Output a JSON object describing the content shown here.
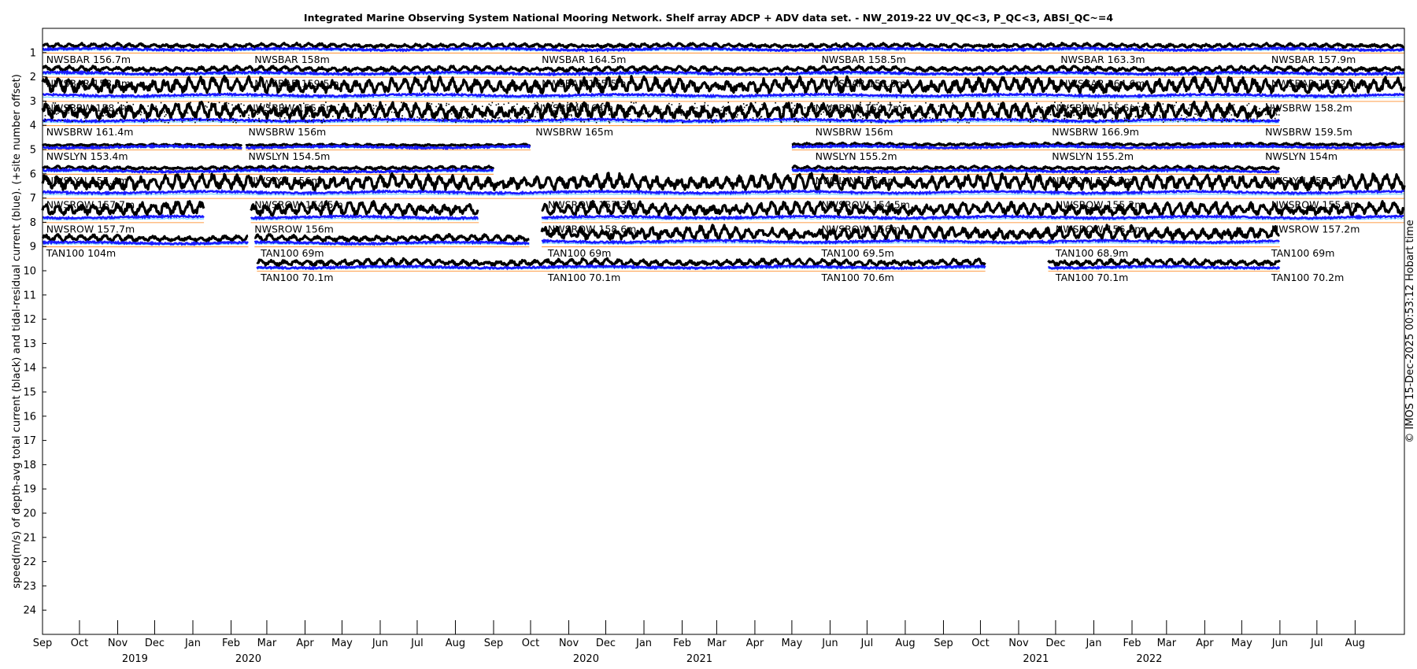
{
  "chart_data": {
    "type": "line",
    "title": "Integrated Marine Observing System National Mooring Network. Shelf array ADCP + ADV data set. - NW_2019-22 UV_QC<3, P_QC<3, ABSI_QC~=4",
    "ylabel": "speed(m/s) of depth-avg total current (black) and tidal-residual current (blue). (+site number offset)",
    "credit": "© IMOS 15-Dec-2025 00:53:12 Hobart time",
    "x_range": [
      "2019-09-01",
      "2022-09-10"
    ],
    "y_range": [
      25,
      0
    ],
    "y_reversed": true,
    "y_ticks": [
      "1",
      "2",
      "3",
      "4",
      "5",
      "6",
      "7",
      "8",
      "9",
      "10",
      "11",
      "12",
      "13",
      "14",
      "15",
      "16",
      "17",
      "18",
      "19",
      "20",
      "21",
      "22",
      "23",
      "24"
    ],
    "x_ticks": [
      {
        "date": "2019-09-01",
        "label": "Sep"
      },
      {
        "date": "2019-10-01",
        "label": "Oct"
      },
      {
        "date": "2019-11-01",
        "label": "Nov"
      },
      {
        "date": "2019-12-01",
        "label": "Dec"
      },
      {
        "date": "2020-01-01",
        "label": "Jan"
      },
      {
        "date": "2020-02-01",
        "label": "Feb"
      },
      {
        "date": "2020-03-01",
        "label": "Mar"
      },
      {
        "date": "2020-04-01",
        "label": "Apr"
      },
      {
        "date": "2020-05-01",
        "label": "May"
      },
      {
        "date": "2020-06-01",
        "label": "Jun"
      },
      {
        "date": "2020-07-01",
        "label": "Jul"
      },
      {
        "date": "2020-08-01",
        "label": "Aug"
      },
      {
        "date": "2020-09-01",
        "label": "Sep"
      },
      {
        "date": "2020-10-01",
        "label": "Oct"
      },
      {
        "date": "2020-11-01",
        "label": "Nov"
      },
      {
        "date": "2020-12-01",
        "label": "Dec"
      },
      {
        "date": "2021-01-01",
        "label": "Jan"
      },
      {
        "date": "2021-02-01",
        "label": "Feb"
      },
      {
        "date": "2021-03-01",
        "label": "Mar"
      },
      {
        "date": "2021-04-01",
        "label": "Apr"
      },
      {
        "date": "2021-05-01",
        "label": "May"
      },
      {
        "date": "2021-06-01",
        "label": "Jun"
      },
      {
        "date": "2021-07-01",
        "label": "Jul"
      },
      {
        "date": "2021-08-01",
        "label": "Aug"
      },
      {
        "date": "2021-09-01",
        "label": "Sep"
      },
      {
        "date": "2021-10-01",
        "label": "Oct"
      },
      {
        "date": "2021-11-01",
        "label": "Nov"
      },
      {
        "date": "2021-12-01",
        "label": "Dec"
      },
      {
        "date": "2022-01-01",
        "label": "Jan"
      },
      {
        "date": "2022-02-01",
        "label": "Feb"
      },
      {
        "date": "2022-03-01",
        "label": "Mar"
      },
      {
        "date": "2022-04-01",
        "label": "Apr"
      },
      {
        "date": "2022-05-01",
        "label": "May"
      },
      {
        "date": "2022-06-01",
        "label": "Jun"
      },
      {
        "date": "2022-07-01",
        "label": "Jul"
      },
      {
        "date": "2022-08-01",
        "label": "Aug"
      }
    ],
    "year_labels": [
      {
        "date": "2019-11-15",
        "label": "2019"
      },
      {
        "date": "2020-02-15",
        "label": "2020"
      },
      {
        "date": "2020-11-15",
        "label": "2020"
      },
      {
        "date": "2021-02-15",
        "label": "2021"
      },
      {
        "date": "2021-11-15",
        "label": "2021"
      },
      {
        "date": "2022-02-15",
        "label": "2022"
      }
    ],
    "colors": {
      "total": "#000000",
      "residual": "#1a1aff",
      "baseline": "#ff7f0e",
      "residual_light": "#66ccff"
    },
    "deployments": [
      {
        "row": 1,
        "start": "2019-09-01",
        "end": "2022-09-10",
        "label": "NWSBAR 156.7m",
        "label_date": "2019-09-04"
      },
      {
        "row": 1,
        "start": "2019-09-01",
        "end": "2022-09-10",
        "label": "NWSBAR 158m",
        "label_date": "2020-02-20"
      },
      {
        "row": 1,
        "start": "2019-09-01",
        "end": "2022-09-10",
        "label": "NWSBAR 164.5m",
        "label_date": "2020-10-10"
      },
      {
        "row": 1,
        "start": "2019-09-01",
        "end": "2022-09-10",
        "label": "NWSBAR 158.5m",
        "label_date": "2021-05-25"
      },
      {
        "row": 1,
        "start": "2019-09-01",
        "end": "2022-09-10",
        "label": "NWSBAR 163.3m",
        "label_date": "2021-12-05"
      },
      {
        "row": 1,
        "start": "2019-09-01",
        "end": "2022-09-10",
        "label": "NWSBAR 157.9m",
        "label_date": "2022-05-25"
      },
      {
        "row": 2,
        "start": "2019-09-01",
        "end": "2022-09-10",
        "label": "NWSBAR 158.2m",
        "label_date": "2019-09-04"
      },
      {
        "row": 2,
        "start": "2019-09-01",
        "end": "2022-09-10",
        "label": "NWSBAR 159.5m",
        "label_date": "2020-02-20"
      },
      {
        "row": 2,
        "start": "2019-09-01",
        "end": "2022-09-10",
        "label": "NWSBAR 165.5m",
        "label_date": "2020-10-10"
      },
      {
        "row": 2,
        "start": "2019-09-01",
        "end": "2022-09-10",
        "label": "NWSBAR 158.5m",
        "label_date": "2021-05-25"
      },
      {
        "row": 2,
        "start": "2019-09-01",
        "end": "2022-09-10",
        "label": "NWSBAR 164.6m",
        "label_date": "2021-12-05"
      },
      {
        "row": 2,
        "start": "2019-09-01",
        "end": "2022-09-10",
        "label": "NWSBAR 159.2m",
        "label_date": "2022-05-25"
      },
      {
        "row": 3,
        "start": "2019-09-01",
        "end": "2022-09-10",
        "label": "NWSBRW 158.4m",
        "label_date": "2019-09-04"
      },
      {
        "row": 3,
        "start": "2019-09-01",
        "end": "2022-09-10",
        "label": "NWSBRW 155.5m",
        "label_date": "2020-02-15"
      },
      {
        "row": 3,
        "start": "2019-09-01",
        "end": "2022-09-10",
        "label": "NWSBRW 164m",
        "label_date": "2020-10-05"
      },
      {
        "row": 3,
        "start": "2019-09-01",
        "end": "2022-09-10",
        "label": "NWSBRW 154.7m",
        "label_date": "2021-05-20"
      },
      {
        "row": 3,
        "start": "2019-09-01",
        "end": "2022-09-10",
        "label": "NWSBRW 155.5m",
        "label_date": "2021-11-28"
      },
      {
        "row": 3,
        "start": "2019-09-01",
        "end": "2022-09-10",
        "label": "NWSBRW 158.2m",
        "label_date": "2022-05-20"
      },
      {
        "row": 4,
        "start": "2019-09-01",
        "end": "2022-06-01",
        "label": "NWSBRW 161.4m",
        "label_date": "2019-09-04"
      },
      {
        "row": 4,
        "start": "2019-09-01",
        "end": "2022-06-01",
        "label": "NWSBRW 156m",
        "label_date": "2020-02-15"
      },
      {
        "row": 4,
        "start": "2019-09-01",
        "end": "2022-06-01",
        "label": "NWSBRW 165m",
        "label_date": "2020-10-05"
      },
      {
        "row": 4,
        "start": "2019-09-01",
        "end": "2022-06-01",
        "label": "NWSBRW 156m",
        "label_date": "2021-05-20"
      },
      {
        "row": 4,
        "start": "2019-09-01",
        "end": "2022-06-01",
        "label": "NWSBRW 166.9m",
        "label_date": "2021-11-28"
      },
      {
        "row": 4,
        "start": "2019-09-01",
        "end": "2022-06-01",
        "label": "NWSBRW 159.5m",
        "label_date": "2022-05-20"
      },
      {
        "row": 5,
        "start": "2019-09-01",
        "end": "2020-02-10",
        "label": "NWSLYN 153.4m",
        "label_date": "2019-09-04"
      },
      {
        "row": 5,
        "start": "2020-02-13",
        "end": "2020-10-01",
        "label": "NWSLYN 154.5m",
        "label_date": "2020-02-15"
      },
      {
        "row": 5,
        "start": "2021-05-01",
        "end": "2022-09-10",
        "label": "NWSLYN 155.2m",
        "label_date": "2021-05-20"
      },
      {
        "row": 5,
        "start": "2021-05-01",
        "end": "2022-09-10",
        "label": "NWSLYN 155.2m",
        "label_date": "2021-11-28"
      },
      {
        "row": 5,
        "start": "2021-05-01",
        "end": "2022-09-10",
        "label": "NWSLYN 154m",
        "label_date": "2022-05-20"
      },
      {
        "row": 6,
        "start": "2019-09-01",
        "end": "2020-09-01",
        "label": "NWSLYN 155.4m",
        "label_date": "2019-09-04"
      },
      {
        "row": 6,
        "start": "2019-09-01",
        "end": "2020-09-01",
        "label": "NWSLYN 156m",
        "label_date": "2020-02-15"
      },
      {
        "row": 6,
        "start": "2021-05-01",
        "end": "2022-06-01",
        "label": "NWSLYN 156.5m",
        "label_date": "2021-05-20"
      },
      {
        "row": 6,
        "start": "2021-05-01",
        "end": "2022-06-01",
        "label": "NWSLYN 156.5m",
        "label_date": "2021-11-28"
      },
      {
        "row": 6,
        "start": "2021-05-01",
        "end": "2022-06-01",
        "label": "NWSLYN 155.3m",
        "label_date": "2022-05-20"
      },
      {
        "row": 7,
        "start": "2019-09-01",
        "end": "2022-09-10",
        "label": "NWSROW 157.7m",
        "label_date": "2019-09-04"
      },
      {
        "row": 7,
        "start": "2019-09-01",
        "end": "2022-09-10",
        "label": "NWSROW 154.5m",
        "label_date": "2020-02-20"
      },
      {
        "row": 7,
        "start": "2019-09-01",
        "end": "2022-09-10",
        "label": "NWSROW 157.3m",
        "label_date": "2020-10-15"
      },
      {
        "row": 7,
        "start": "2019-09-01",
        "end": "2022-09-10",
        "label": "NWSROW 154.5m",
        "label_date": "2021-05-25"
      },
      {
        "row": 7,
        "start": "2019-09-01",
        "end": "2022-09-10",
        "label": "NWSROW 155.2m",
        "label_date": "2021-12-01"
      },
      {
        "row": 7,
        "start": "2019-09-01",
        "end": "2022-09-10",
        "label": "NWSROW 155.9m",
        "label_date": "2022-05-25"
      },
      {
        "row": 8,
        "start": "2019-09-01",
        "end": "2020-01-10",
        "label": "NWSROW 157.7m",
        "label_date": "2019-09-04"
      },
      {
        "row": 8,
        "start": "2020-02-17",
        "end": "2020-08-20",
        "label": "NWSROW 156m",
        "label_date": "2020-02-20"
      },
      {
        "row": 8,
        "start": "2020-10-10",
        "end": "2022-09-10",
        "label": "NWSROW 158.6m",
        "label_date": "2020-10-15"
      },
      {
        "row": 8,
        "start": "2020-10-10",
        "end": "2022-09-10",
        "label": "NWSROW 156m",
        "label_date": "2021-05-25"
      },
      {
        "row": 8,
        "start": "2020-10-10",
        "end": "2022-09-10",
        "label": "NWSROW 156.5m",
        "label_date": "2021-12-01"
      },
      {
        "row": 8,
        "start": "2020-10-10",
        "end": "2022-09-10",
        "label": "NWSROW 157.2m",
        "label_date": "2022-05-25"
      },
      {
        "row": 9,
        "start": "2019-09-01",
        "end": "2020-02-15",
        "label": "TAN100 104m",
        "label_date": "2019-09-04"
      },
      {
        "row": 9,
        "start": "2020-02-20",
        "end": "2020-09-30",
        "label": "TAN100 69m",
        "label_date": "2020-02-25"
      },
      {
        "row": 9,
        "start": "2020-10-10",
        "end": "2022-06-01",
        "label": "TAN100 69m",
        "label_date": "2020-10-15"
      },
      {
        "row": 9,
        "start": "2020-10-10",
        "end": "2022-06-01",
        "label": "TAN100 69.5m",
        "label_date": "2021-05-25"
      },
      {
        "row": 9,
        "start": "2020-10-10",
        "end": "2022-06-01",
        "label": "TAN100 68.9m",
        "label_date": "2021-12-01"
      },
      {
        "row": 9,
        "start": "2020-10-10",
        "end": "2022-06-01",
        "label": "TAN100 69m",
        "label_date": "2022-05-25"
      },
      {
        "row": 10,
        "start": "2020-02-22",
        "end": "2021-10-05",
        "label": "TAN100 70.1m",
        "label_date": "2020-02-25"
      },
      {
        "row": 10,
        "start": "2020-02-22",
        "end": "2021-10-05",
        "label": "TAN100 70.1m",
        "label_date": "2020-10-15"
      },
      {
        "row": 10,
        "start": "2020-02-22",
        "end": "2021-10-05",
        "label": "TAN100 70.6m",
        "label_date": "2021-05-25"
      },
      {
        "row": 10,
        "start": "2021-11-25",
        "end": "2022-06-01",
        "label": "TAN100 70.1m",
        "label_date": "2021-12-01"
      },
      {
        "row": 10,
        "start": "2021-11-25",
        "end": "2022-06-01",
        "label": "TAN100 70.2m",
        "label_date": "2022-05-25"
      }
    ],
    "traces": [
      {
        "row": 1,
        "start": "2019-09-01",
        "end": "2022-09-10",
        "mean_speed": 0.18,
        "amplitude": 0.1,
        "scatter": false
      },
      {
        "row": 2,
        "start": "2019-09-01",
        "end": "2022-09-10",
        "mean_speed": 0.2,
        "amplitude": 0.12,
        "scatter": false
      },
      {
        "row": 3,
        "start": "2019-09-01",
        "end": "2022-09-10",
        "mean_speed": 0.35,
        "amplitude": 0.35,
        "scatter": false
      },
      {
        "row": 4,
        "start": "2019-09-01",
        "end": "2022-06-01",
        "mean_speed": 0.3,
        "amplitude": 0.35,
        "scatter": true
      },
      {
        "row": 5,
        "start": "2019-09-01",
        "end": "2020-02-10",
        "mean_speed": 0.12,
        "amplitude": 0.05,
        "scatter": false
      },
      {
        "row": 5,
        "start": "2020-02-13",
        "end": "2020-10-01",
        "mean_speed": 0.12,
        "amplitude": 0.05,
        "scatter": false
      },
      {
        "row": 5,
        "start": "2021-05-01",
        "end": "2022-09-10",
        "mean_speed": 0.14,
        "amplitude": 0.06,
        "scatter": false
      },
      {
        "row": 6,
        "start": "2019-09-01",
        "end": "2020-09-01",
        "mean_speed": 0.15,
        "amplitude": 0.08,
        "scatter": false
      },
      {
        "row": 6,
        "start": "2021-05-01",
        "end": "2022-06-01",
        "mean_speed": 0.15,
        "amplitude": 0.08,
        "scatter": false
      },
      {
        "row": 7,
        "start": "2019-09-01",
        "end": "2022-09-10",
        "mean_speed": 0.35,
        "amplitude": 0.35,
        "scatter": false
      },
      {
        "row": 8,
        "start": "2019-09-01",
        "end": "2020-01-10",
        "mean_speed": 0.3,
        "amplitude": 0.3,
        "scatter": false
      },
      {
        "row": 8,
        "start": "2020-02-17",
        "end": "2020-08-20",
        "mean_speed": 0.3,
        "amplitude": 0.3,
        "scatter": false
      },
      {
        "row": 8,
        "start": "2020-10-10",
        "end": "2022-09-10",
        "mean_speed": 0.3,
        "amplitude": 0.3,
        "scatter": false
      },
      {
        "row": 9,
        "start": "2019-09-01",
        "end": "2020-02-15",
        "mean_speed": 0.2,
        "amplitude": 0.15,
        "scatter": false
      },
      {
        "row": 9,
        "start": "2020-02-20",
        "end": "2020-09-30",
        "mean_speed": 0.2,
        "amplitude": 0.15,
        "scatter": false
      },
      {
        "row": 9,
        "start": "2020-10-10",
        "end": "2022-06-01",
        "mean_speed": 0.3,
        "amplitude": 0.3,
        "scatter": false
      },
      {
        "row": 10,
        "start": "2020-02-22",
        "end": "2021-10-05",
        "mean_speed": 0.2,
        "amplitude": 0.15,
        "scatter": false
      },
      {
        "row": 10,
        "start": "2021-11-25",
        "end": "2022-06-01",
        "mean_speed": 0.2,
        "amplitude": 0.15,
        "scatter": false
      }
    ]
  }
}
